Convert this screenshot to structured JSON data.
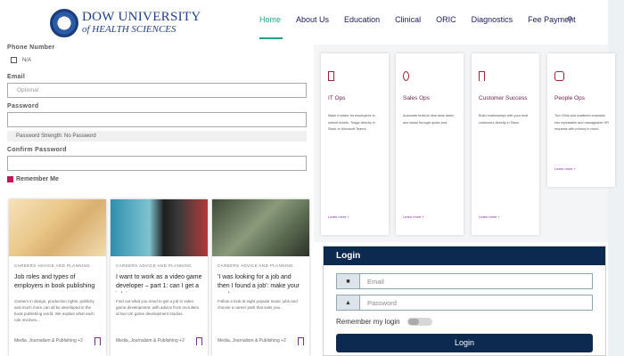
{
  "header": {
    "logo_line1": "DOW UNIVERSITY",
    "logo_line2": "of HEALTH SCIENCES",
    "nav": [
      "Home",
      "About Us",
      "Education",
      "Clinical",
      "ORIC",
      "Diagnostics",
      "Fee Payment"
    ],
    "active": "Home"
  },
  "form": {
    "phone_label": "Phone Number",
    "phone_option": "N/A",
    "email_label": "Email",
    "email_placeholder": "Optional",
    "password_label": "Password",
    "password_strength": "Password Strength: No Password",
    "confirm_label": "Confirm Password",
    "remember_label": "Remember Me"
  },
  "cards": [
    {
      "category": "CAREERS ADVICE AND PLANNING",
      "title": "Job roles and types of employers in book publishing",
      "body": "Careers in design, production rights, publicity and much more can all be developed in the book publishing world. We explain what each role involves...",
      "tag": "Media, Journalism & Publishing +2"
    },
    {
      "category": "CAREERS ADVICE AND PLANNING",
      "title": "I want to work as a video game developer – part 1: can I get a job i...",
      "body": "Find out what you need to get a job in video game development, with advice from recruiters at two UK game development studios.",
      "tag": "Media, Journalism & Publishing +2"
    },
    {
      "category": "CAREERS ADVICE AND PLANNING",
      "title": "'I was looking for a job and then I found a job': make your mark on...",
      "body": "Follow a look at eight popular music jobs and choose a career path that suits you.",
      "tag": "Media, Journalism & Publishing +2"
    }
  ],
  "teams": [
    {
      "title": "IT Ops",
      "desc": "Make it easier for employees to submit tickets. Triage directly in Slack or Microsoft Teams.",
      "link": "Learn more +"
    },
    {
      "title": "Sales Ops",
      "desc": "Automate tedious deal desk tasks and assist through quote-end.",
      "link": "Learn more +"
    },
    {
      "title": "Customer Success",
      "desc": "Build relationships with your best customers directly in Slack.",
      "link": "Learn more +"
    },
    {
      "title": "People Ops",
      "desc": "Turn DMs and scattered channels into repeatable and manageable HR requests with privacy in mind.",
      "link": "Learn more +"
    }
  ],
  "login": {
    "title": "Login",
    "email_placeholder": "Email",
    "password_placeholder": "Password",
    "remember": "Remember my login",
    "button": "Login"
  },
  "colors": {
    "accent": "#1da58a",
    "navy": "#0c2a50",
    "maroon": "#a3203b"
  }
}
